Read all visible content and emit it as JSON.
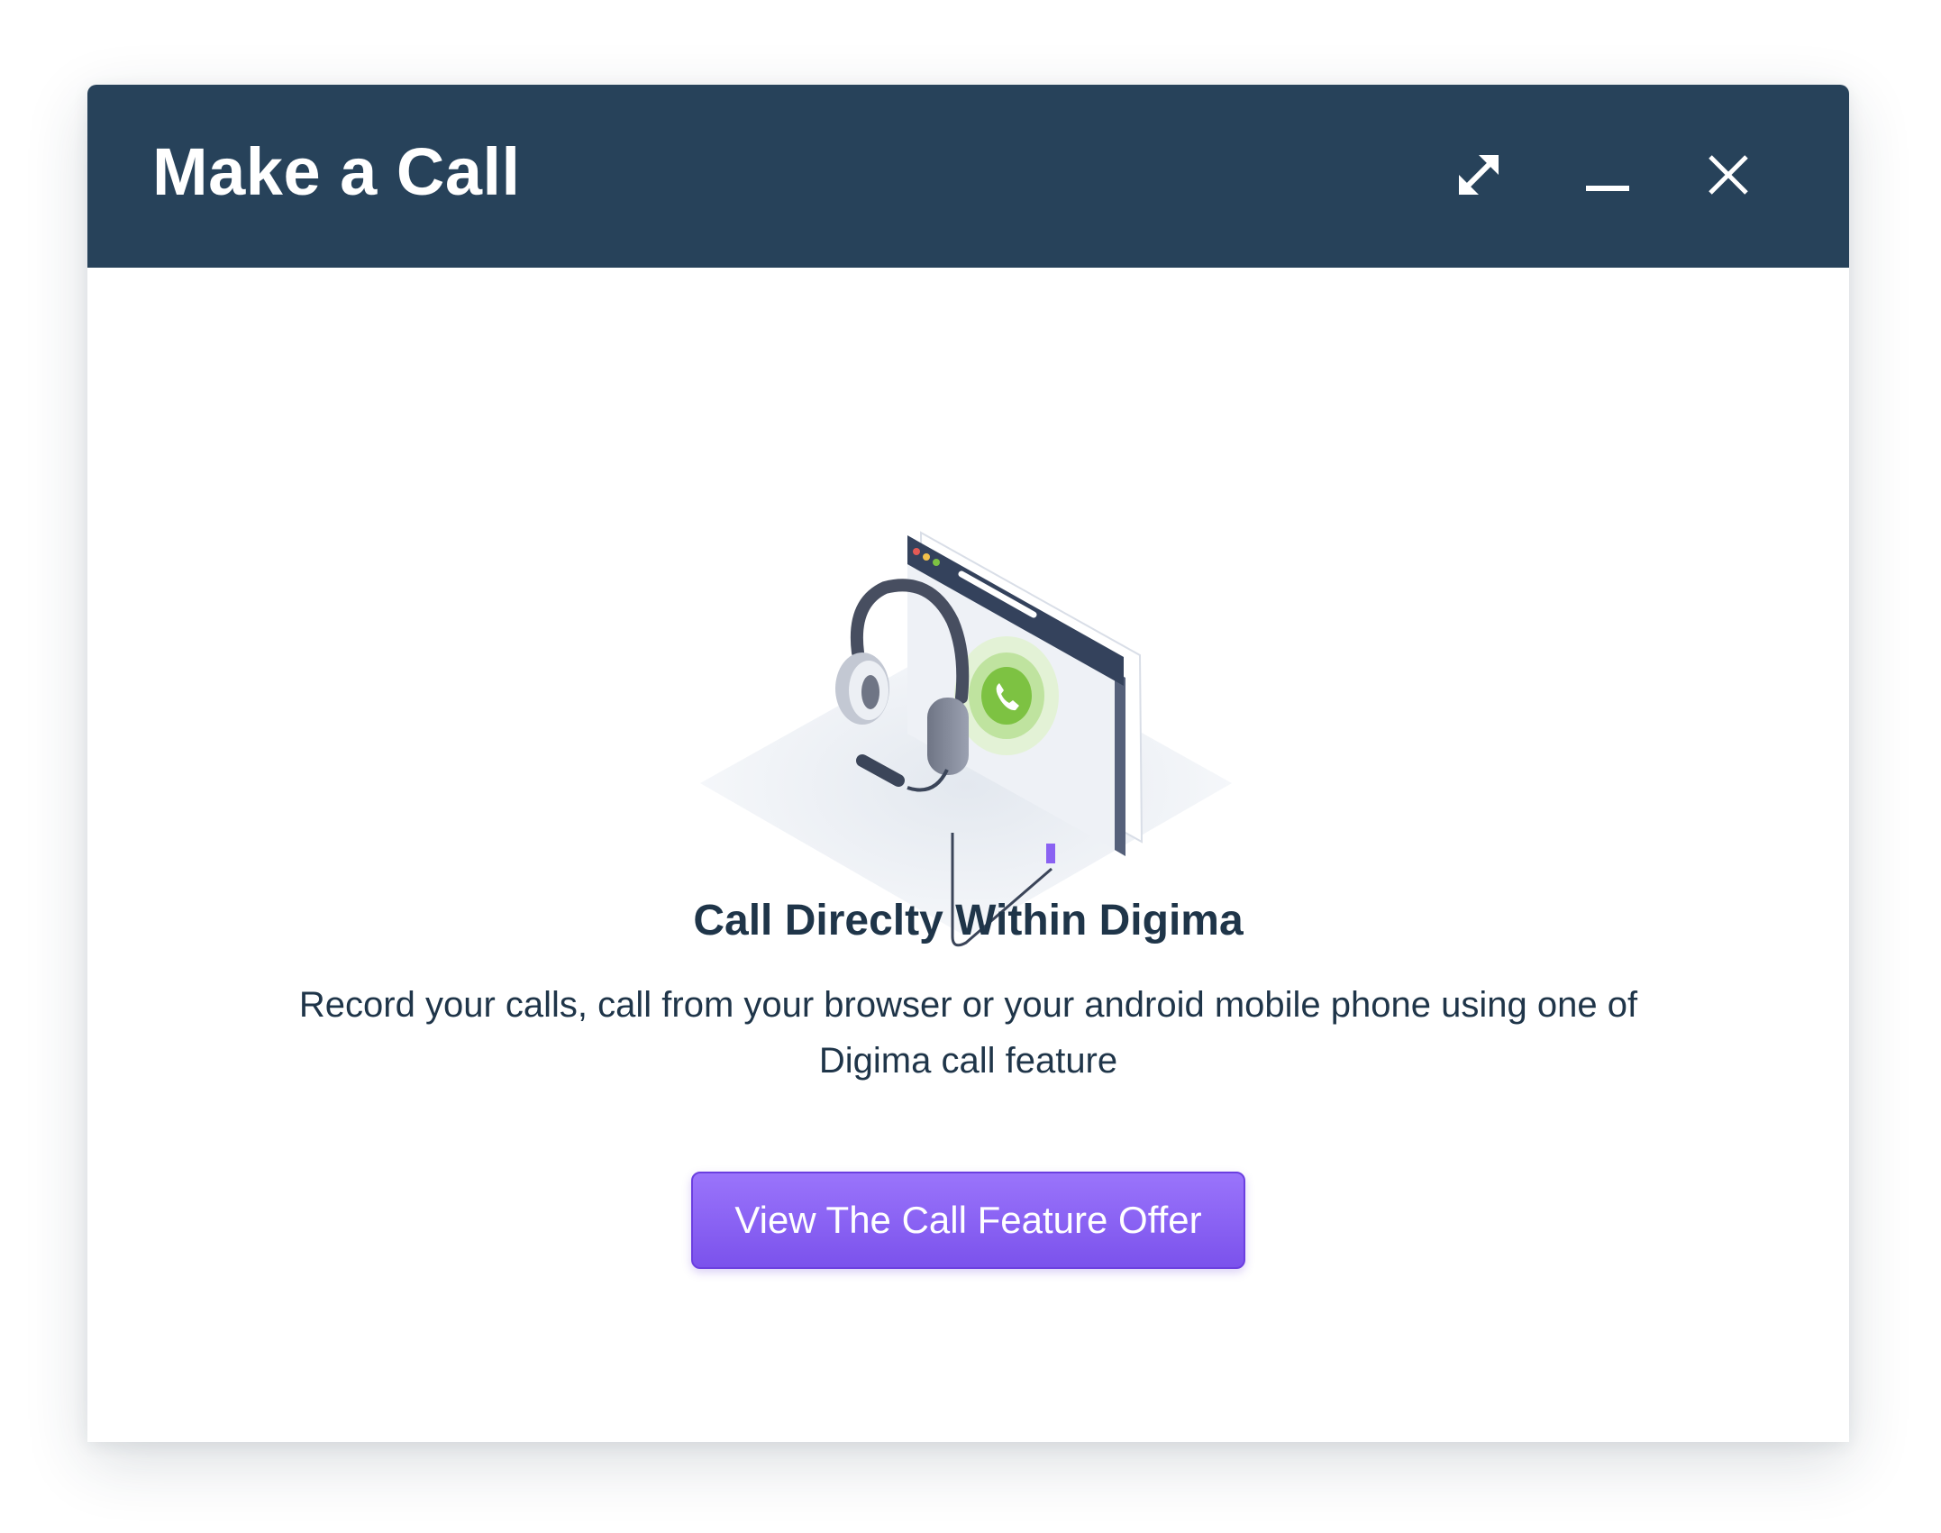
{
  "window": {
    "title": "Make a Call",
    "controls": {
      "expand_icon": "expand-arrows-icon",
      "minimize_icon": "minimize-icon",
      "close_icon": "close-x-icon"
    }
  },
  "content": {
    "illustration": "headset-browser-call-illustration",
    "heading": "Call Direclty Within Digima",
    "description": "Record your calls, call from your browser or your android mobile phone using one of Digima call feature",
    "cta_label": "View The Call Feature Offer"
  },
  "colors": {
    "header_bg": "#27425a",
    "heading_text": "#1f3549",
    "cta_bg": "#8660f3",
    "call_green": "#7dc242"
  }
}
